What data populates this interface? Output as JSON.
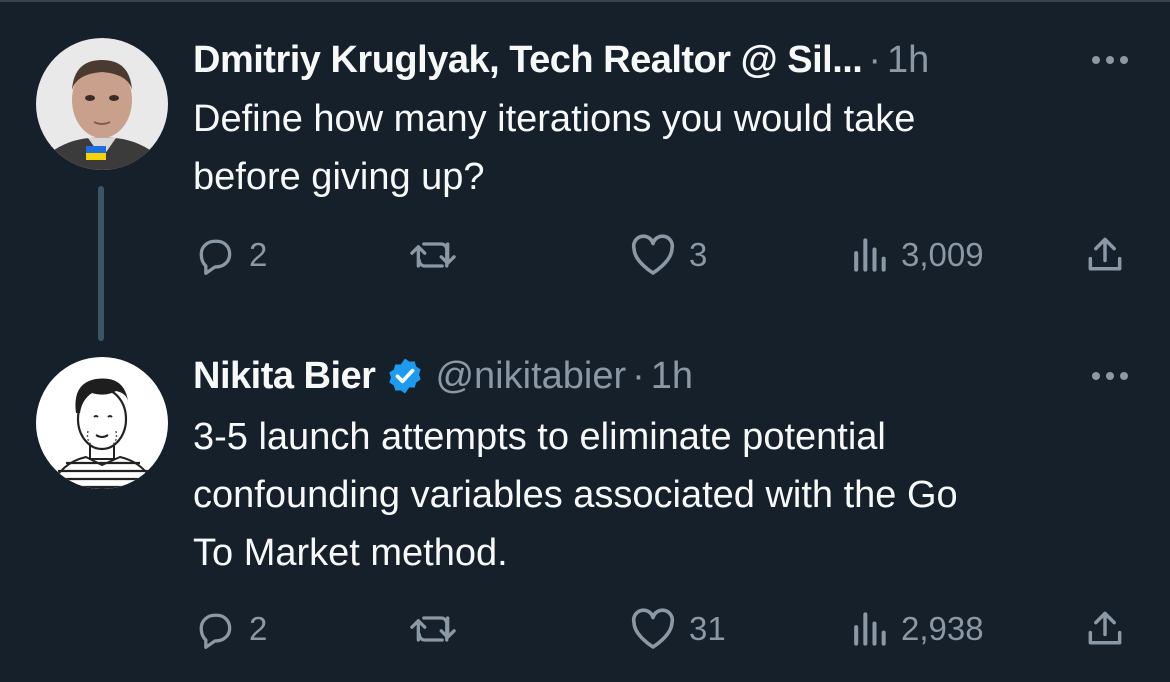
{
  "tweets": [
    {
      "author_name": "Dmitriy Kruglyak, Tech Realtor @ Sil...",
      "handle": "",
      "separator": "·",
      "time": "1h",
      "verified": false,
      "text_lines": [
        "Define how many iterations you would take",
        "before giving up?"
      ],
      "replies": "2",
      "retweets": "",
      "likes": "3",
      "views": "3,009",
      "avatar_icon": "avatar-photo-man-with-ukraine-flag"
    },
    {
      "author_name": "Nikita Bier",
      "handle": "@nikitabier",
      "separator": "·",
      "time": "1h",
      "verified": true,
      "text_lines": [
        "3-5 launch attempts to eliminate potential",
        "confounding variables associated with the Go",
        "To Market method."
      ],
      "replies": "2",
      "retweets": "",
      "likes": "31",
      "views": "2,938",
      "avatar_icon": "avatar-sketch-man-striped-shirt"
    }
  ],
  "colors": {
    "background": "#15202b",
    "primary_text": "#f7f9f9",
    "secondary_text": "#8b98a5",
    "thread_line": "#3d5466",
    "verified_badge": "#1d9bf0"
  },
  "icons": {
    "more": "more-horizontal-icon",
    "reply": "reply-bubble-icon",
    "retweet": "retweet-arrows-icon",
    "like": "heart-icon",
    "views": "bar-chart-icon",
    "share": "share-upload-icon",
    "verified": "verified-badge-icon"
  }
}
